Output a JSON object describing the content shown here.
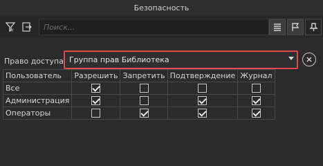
{
  "window": {
    "title": "Безопасность"
  },
  "toolbar": {
    "search_placeholder": "Поиск...",
    "left_icons": [
      "filter-icon",
      "export-icon"
    ],
    "right_icons": [
      "list-icon",
      "flag-icon",
      "pin-icon"
    ]
  },
  "access": {
    "label": "Право доступа:",
    "selected": "Группа прав Библиотека"
  },
  "permissions": {
    "columns": [
      "Пользователь",
      "Разрешить",
      "Запретить",
      "Подтверждение",
      "Журнал"
    ],
    "rows": [
      {
        "name": "Все",
        "values": [
          true,
          false,
          false,
          false
        ]
      },
      {
        "name": "Администрация",
        "values": [
          true,
          false,
          true,
          true
        ]
      },
      {
        "name": "Операторы",
        "values": [
          false,
          true,
          true,
          true
        ]
      }
    ]
  },
  "colors": {
    "highlight": "#e04a4a",
    "background": "#2b2b2b"
  }
}
